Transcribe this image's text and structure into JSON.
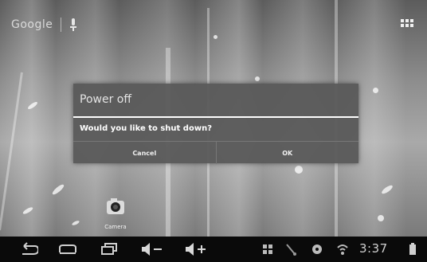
{
  "search": {
    "logo_text": "Google"
  },
  "dialog": {
    "title": "Power off",
    "message": "Would you like to shut down?",
    "cancel_label": "Cancel",
    "ok_label": "OK"
  },
  "desktop": {
    "camera_label": "Camera"
  },
  "status": {
    "time": "3:37"
  },
  "colors": {
    "dialog_bg": "#585858",
    "navbar_bg": "#0a0a0a",
    "rule": "#ffffff"
  },
  "icons": [
    "microphone-icon",
    "apps-grid-icon",
    "camera-icon",
    "back-icon",
    "home-icon",
    "recent-apps-icon",
    "volume-down-icon",
    "volume-up-icon",
    "screenshot-icon",
    "usb-icon",
    "sdcard-icon",
    "wifi-icon",
    "battery-icon"
  ]
}
